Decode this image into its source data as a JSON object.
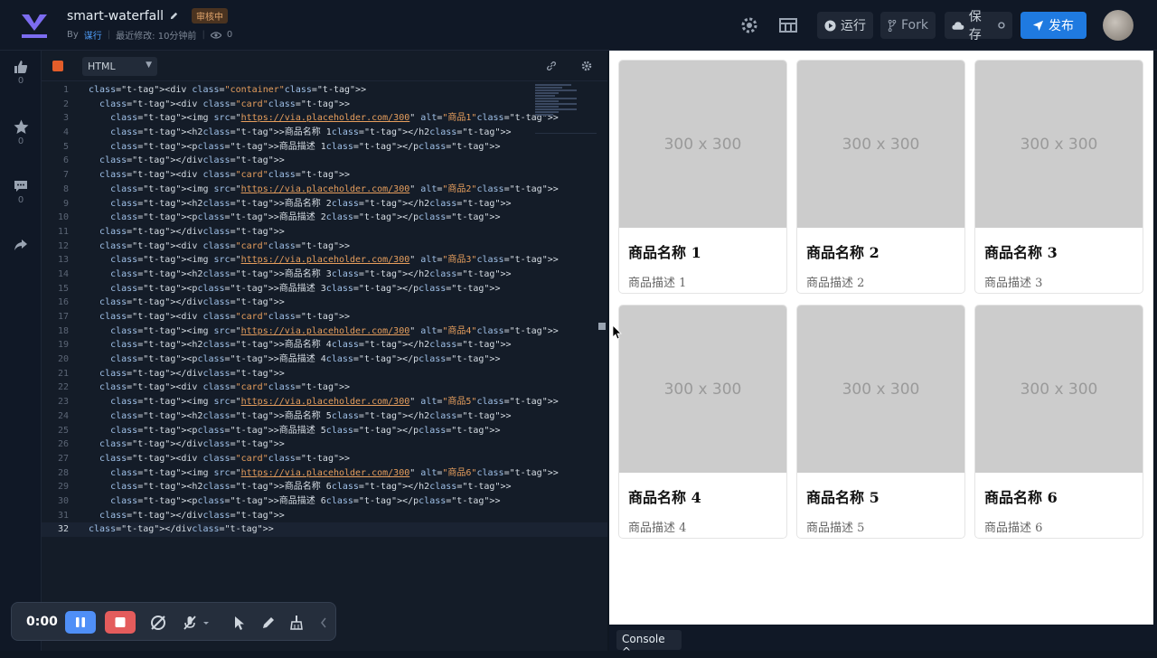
{
  "project": {
    "title": "smart-waterfall",
    "badge": "审核中",
    "by_label": "By",
    "author": "谋行",
    "modified": "最近修改: 10分钟前",
    "views": "0"
  },
  "toolbar": {
    "run_label": "运行",
    "fork_label": "Fork",
    "save_label": "保存",
    "publish_label": "发布"
  },
  "sidebar": {
    "like_count": "0",
    "star_count": "0",
    "comment_count": "0"
  },
  "editor": {
    "language": "HTML",
    "lines": [
      {
        "n": "1",
        "text": "<div class=\"container\">"
      },
      {
        "n": "2",
        "text": "  <div class=\"card\">"
      },
      {
        "n": "3",
        "text": "    <img src=\"https://via.placeholder.com/300\" alt=\"商品1\">"
      },
      {
        "n": "4",
        "text": "    <h2>商品名称 1</h2>"
      },
      {
        "n": "5",
        "text": "    <p>商品描述 1</p>"
      },
      {
        "n": "6",
        "text": "  </div>"
      },
      {
        "n": "7",
        "text": "  <div class=\"card\">"
      },
      {
        "n": "8",
        "text": "    <img src=\"https://via.placeholder.com/300\" alt=\"商品2\">"
      },
      {
        "n": "9",
        "text": "    <h2>商品名称 2</h2>"
      },
      {
        "n": "10",
        "text": "    <p>商品描述 2</p>"
      },
      {
        "n": "11",
        "text": "  </div>"
      },
      {
        "n": "12",
        "text": "  <div class=\"card\">"
      },
      {
        "n": "13",
        "text": "    <img src=\"https://via.placeholder.com/300\" alt=\"商品3\">"
      },
      {
        "n": "14",
        "text": "    <h2>商品名称 3</h2>"
      },
      {
        "n": "15",
        "text": "    <p>商品描述 3</p>"
      },
      {
        "n": "16",
        "text": "  </div>"
      },
      {
        "n": "17",
        "text": "  <div class=\"card\">"
      },
      {
        "n": "18",
        "text": "    <img src=\"https://via.placeholder.com/300\" alt=\"商品4\">"
      },
      {
        "n": "19",
        "text": "    <h2>商品名称 4</h2>"
      },
      {
        "n": "20",
        "text": "    <p>商品描述 4</p>"
      },
      {
        "n": "21",
        "text": "  </div>"
      },
      {
        "n": "22",
        "text": "  <div class=\"card\">"
      },
      {
        "n": "23",
        "text": "    <img src=\"https://via.placeholder.com/300\" alt=\"商品5\">"
      },
      {
        "n": "24",
        "text": "    <h2>商品名称 5</h2>"
      },
      {
        "n": "25",
        "text": "    <p>商品描述 5</p>"
      },
      {
        "n": "26",
        "text": "  </div>"
      },
      {
        "n": "27",
        "text": "  <div class=\"card\">"
      },
      {
        "n": "28",
        "text": "    <img src=\"https://via.placeholder.com/300\" alt=\"商品6\">"
      },
      {
        "n": "29",
        "text": "    <h2>商品名称 6</h2>"
      },
      {
        "n": "30",
        "text": "    <p>商品描述 6</p>"
      },
      {
        "n": "31",
        "text": "  </div>"
      },
      {
        "n": "32",
        "text": "</div>"
      }
    ]
  },
  "preview": {
    "cards": [
      {
        "placeholder": "300 x 300",
        "title": "商品名称 1",
        "desc": "商品描述 1"
      },
      {
        "placeholder": "300 x 300",
        "title": "商品名称 2",
        "desc": "商品描述 2"
      },
      {
        "placeholder": "300 x 300",
        "title": "商品名称 3",
        "desc": "商品描述 3"
      },
      {
        "placeholder": "300 x 300",
        "title": "商品名称 4",
        "desc": "商品描述 4"
      },
      {
        "placeholder": "300 x 300",
        "title": "商品名称 5",
        "desc": "商品描述 5"
      },
      {
        "placeholder": "300 x 300",
        "title": "商品名称 6",
        "desc": "商品描述 6"
      }
    ]
  },
  "console": {
    "label": "Console ^"
  },
  "recorder": {
    "time": "0:00"
  },
  "colors": {
    "accent": "#1f7ae0",
    "pause": "#4f8ff7",
    "stop": "#e45c5c",
    "badge": "#e0a46c"
  }
}
